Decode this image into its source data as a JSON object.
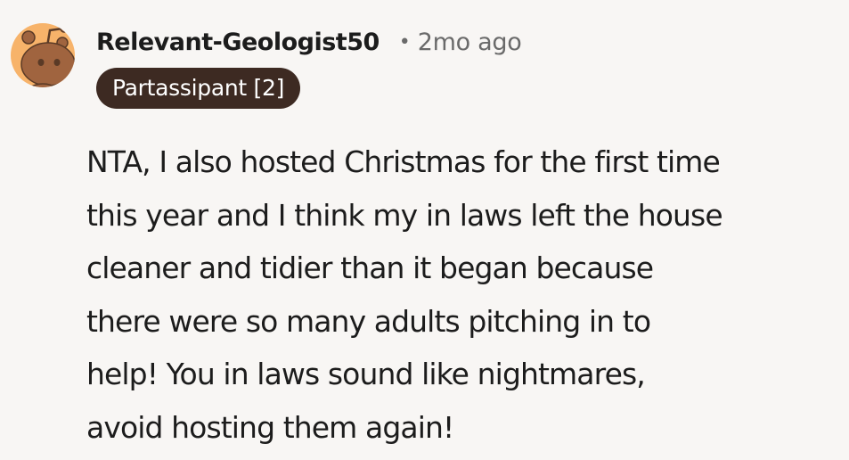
{
  "comment": {
    "author": "Relevant-Geologist50",
    "separator": "•",
    "timestamp": "2mo ago",
    "flair": "Partassipant [2]",
    "avatar_icon": "snoo-avatar-icon",
    "body_lines": [
      "NTA, I also hosted Christmas for the first time",
      "this year and I think my in laws left the house",
      "cleaner and tidier than it began because",
      "there were so many adults pitching in to",
      "help! You in laws sound like nightmares,",
      "avoid hosting them again!"
    ]
  },
  "colors": {
    "background": "#f8f6f4",
    "avatar_bg": "#f7b36a",
    "avatar_figure": "#a0643f",
    "flair_bg": "#3d2a22",
    "flair_text": "#ffffff",
    "text": "#1c1c1c",
    "muted": "#6a6a6a"
  }
}
